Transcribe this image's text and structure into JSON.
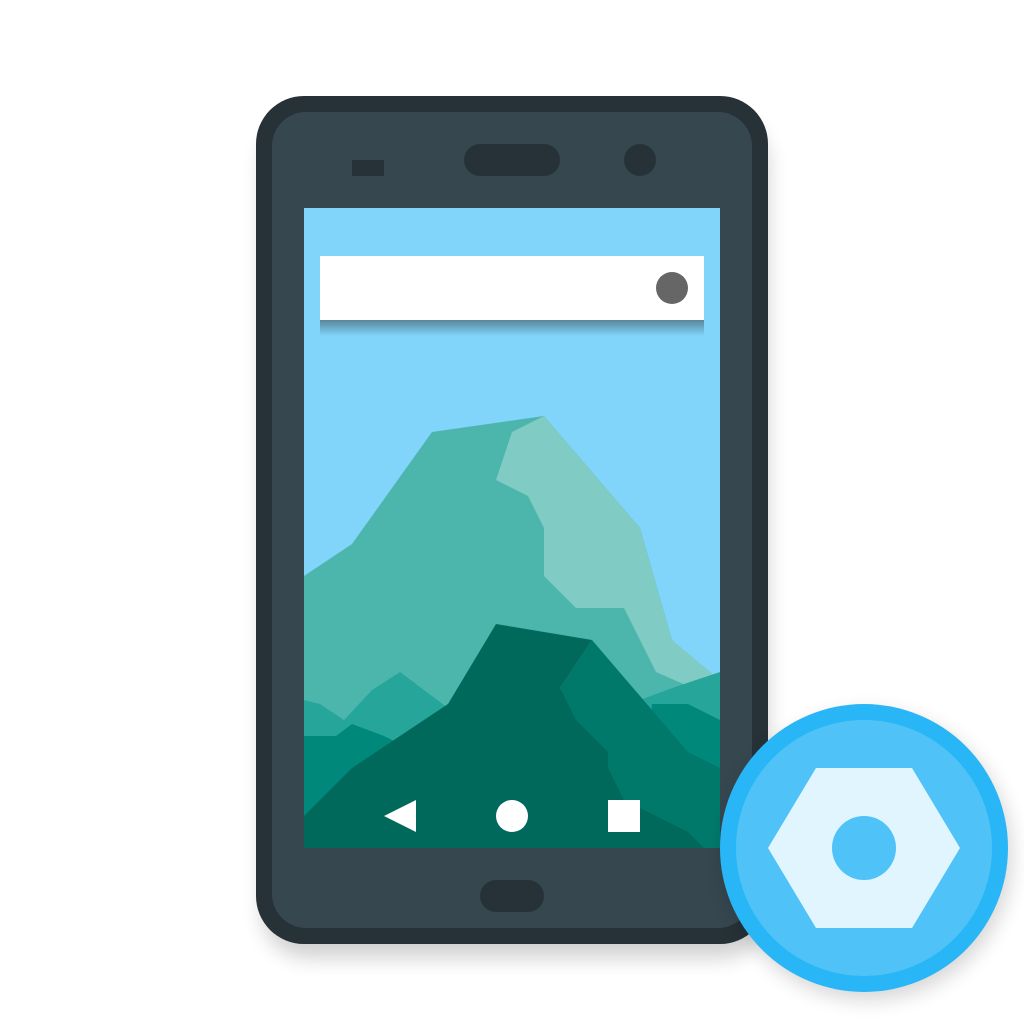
{
  "colors": {
    "phone_outer": "#263238",
    "phone_body": "#37474F",
    "sky": "#81D4FA",
    "search_bar": "#FFFFFF",
    "search_dot": "#666666",
    "mountain_light": "#80CBC4",
    "mountain_mid": "#4DB6AC",
    "mountain_teal": "#26A69A",
    "mountain_green": "#00897B",
    "mountain_dark": "#00695C",
    "mountain_mid_dark": "#00796B",
    "nav_icons": "#FFFFFF",
    "badge_ring": "#29B6F6",
    "badge_fill": "#4FC3F7",
    "badge_hexagon": "#E1F5FE"
  },
  "icons": {
    "phone": "smartphone-icon",
    "nav_back": "back-triangle-icon",
    "nav_home": "home-circle-icon",
    "nav_recents": "recents-square-icon",
    "badge": "settings-nut-icon"
  }
}
